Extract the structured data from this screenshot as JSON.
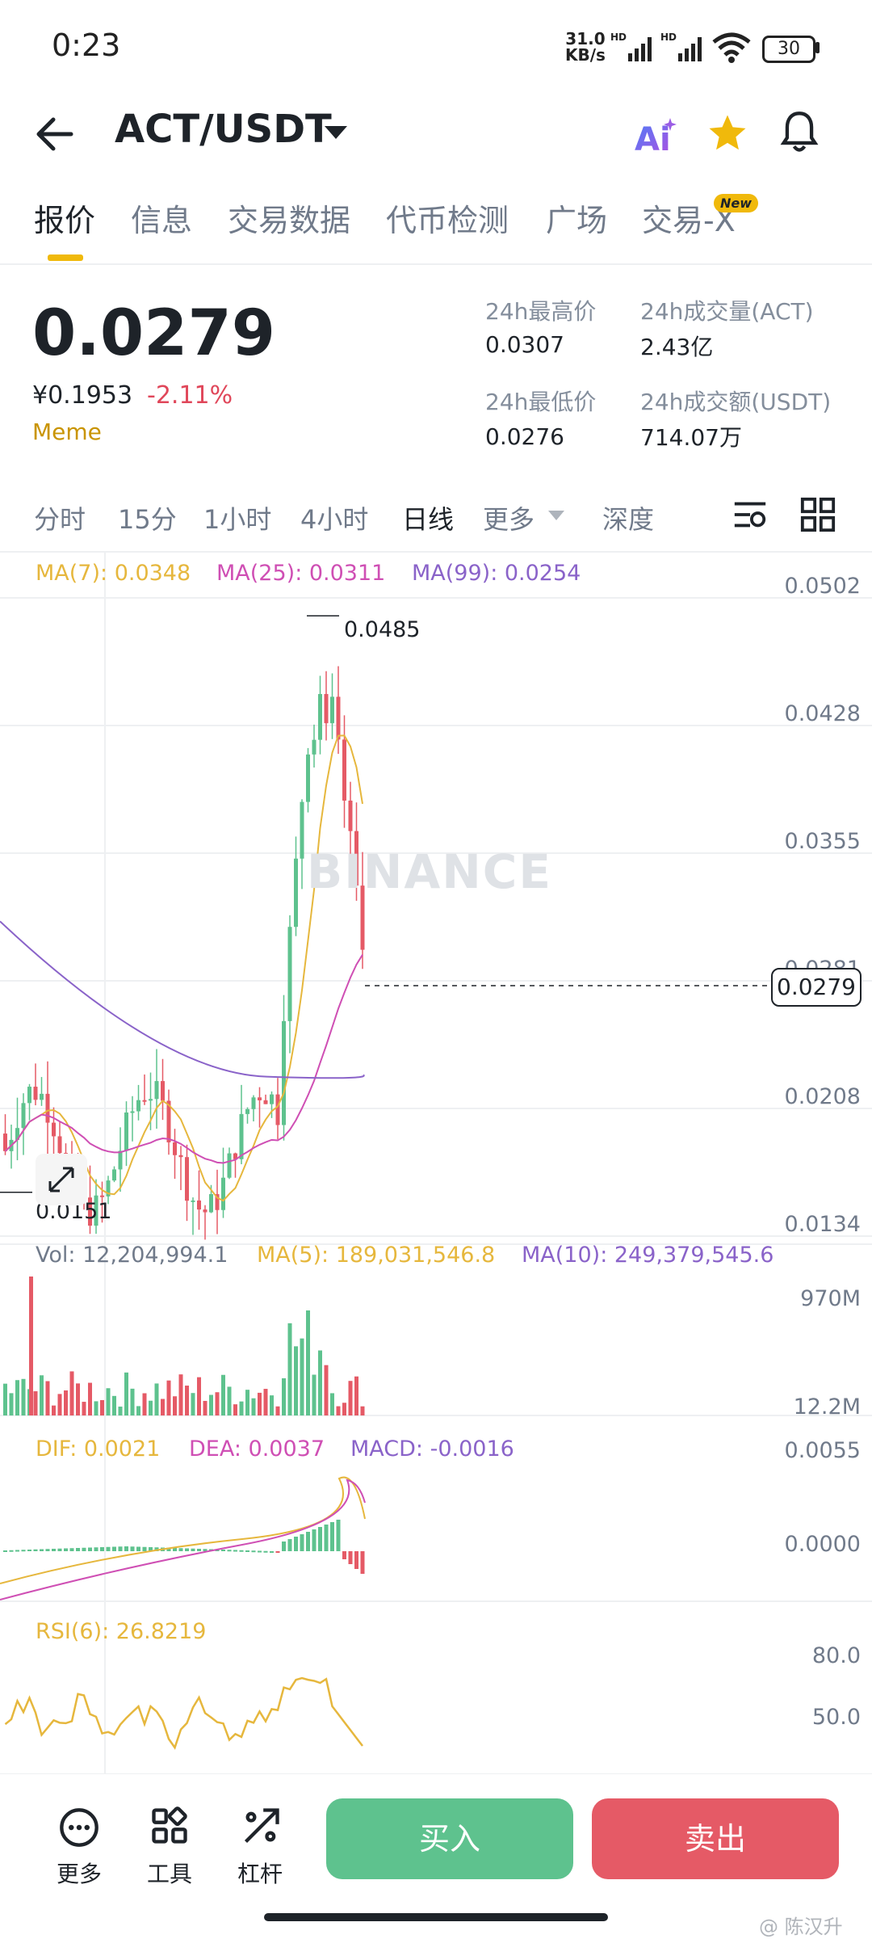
{
  "status_bar": {
    "time": "0:23",
    "net_speed_value": "31.0",
    "net_speed_unit": "KB/s",
    "battery": "30"
  },
  "header": {
    "pair": "ACT/USDT",
    "icons": [
      "back-arrow-icon",
      "ai-icon",
      "star-icon",
      "bell-icon"
    ]
  },
  "tabs": [
    "报价",
    "信息",
    "交易数据",
    "代币检测",
    "广场",
    "交易-X"
  ],
  "new_badge": "New",
  "price": {
    "last": "0.0279",
    "cny": "¥0.1953",
    "change": "-2.11%",
    "tag": "Meme"
  },
  "stats": {
    "high_label": "24h最高价",
    "high_value": "0.0307",
    "low_label": "24h最低价",
    "low_value": "0.0276",
    "vol_label": "24h成交量(ACT)",
    "vol_value": "2.43亿",
    "amount_label": "24h成交额(USDT)",
    "amount_value": "714.07万"
  },
  "intervals": [
    "分时",
    "15分",
    "1小时",
    "4小时",
    "日线",
    "更多",
    "深度"
  ],
  "indicators": {
    "ma7": "MA(7): 0.0348",
    "ma25": "MA(25): 0.0311",
    "ma99": "MA(99): 0.0254",
    "vol": "Vol: 12,204,994.1",
    "vol_ma5": "MA(5): 189,031,546.8",
    "vol_ma10": "MA(10): 249,379,545.6",
    "dif": "DIF: 0.0021",
    "dea": "DEA: 0.0037",
    "macd": "MACD: -0.0016",
    "rsi": "RSI(6): 26.8219"
  },
  "price_axis": [
    "0.0502",
    "0.0428",
    "0.0355",
    "0.0281",
    "0.0208",
    "0.0134"
  ],
  "high_marker": "0.0485",
  "low_marker": "0.0151",
  "current_price_tag": "0.0279",
  "vol_axis": [
    "970M",
    "12.2M"
  ],
  "macd_axis": [
    "0.0055",
    "0.0000"
  ],
  "rsi_axis": [
    "80.0",
    "50.0"
  ],
  "watermark": "BINANCE",
  "colors": {
    "up": "#5ec28e",
    "down": "#e55a66",
    "ma7": "#e6b73d",
    "ma25": "#cf4fb4",
    "ma99": "#8a63c9",
    "accent": "#f0b90b"
  },
  "bottom_bar": {
    "more": "更多",
    "tools": "工具",
    "leverage": "杠杆",
    "buy": "买入",
    "sell": "卖出"
  },
  "credit": "@ 陈汉升"
}
